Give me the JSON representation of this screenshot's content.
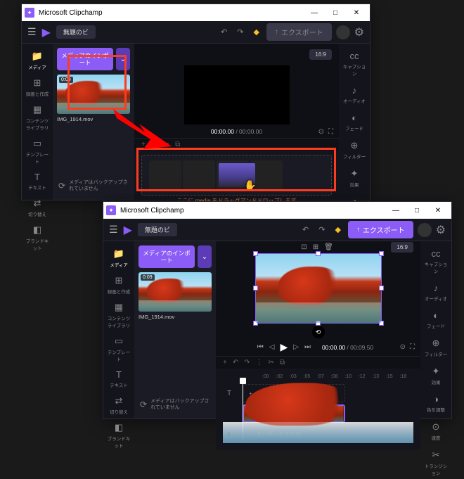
{
  "app": {
    "title": "Microsoft Clipchamp"
  },
  "win_controls": {
    "min": "—",
    "max": "□",
    "close": "✕"
  },
  "topbar": {
    "doc_title": "無題の‍ビ",
    "undo_icon": "↶",
    "redo_icon": "↷",
    "diamond_icon": "◆",
    "export_label": "エクスポート",
    "export_icon": "↑"
  },
  "aspect_ratio": "16:9",
  "left_rail": [
    {
      "icon": "📁",
      "label": "メディア"
    },
    {
      "icon": "⊞",
      "label": "録画と作成"
    },
    {
      "icon": "▦",
      "label": "コンテンツライブラリ"
    },
    {
      "icon": "▭",
      "label": "テンプレート"
    },
    {
      "icon": "T",
      "label": "テキスト"
    },
    {
      "icon": "⇄",
      "label": "切り替え"
    },
    {
      "icon": "◧",
      "label": "ブランドキット"
    }
  ],
  "media": {
    "import_label": "メディアのインポート",
    "chevron": "⌄",
    "clip": {
      "duration": "0:09",
      "filename": "IMG_1914.mov"
    },
    "backup_msg": "メディアはバックアップされていません"
  },
  "right_rail": [
    {
      "icon": "cc",
      "label": "キャプション"
    },
    {
      "icon": "♪",
      "label": "オーディオ"
    },
    {
      "icon": "◐",
      "label": "フェード"
    },
    {
      "icon": "⊕",
      "label": "フィルター"
    },
    {
      "icon": "✦",
      "label": "効果"
    },
    {
      "icon": "◑",
      "label": "色を調整"
    },
    {
      "icon": "⊙",
      "label": "速度"
    },
    {
      "icon": "✂",
      "label": "トランジション"
    }
  ],
  "playback": {
    "skip_back": "⏮",
    "prev": "◁",
    "play": "▶",
    "next": "▷",
    "skip_fwd": "⏭",
    "time_cur": "00:00.00",
    "time_sep": " / ",
    "time_tot_a": "00:00.00",
    "time_tot_b": "00:09.50",
    "full": "⛶",
    "search": "⊙"
  },
  "crop_tools": {
    "crop": "⊡",
    "fit": "⊞",
    "trash": "🗑"
  },
  "toolbar": {
    "plus": "+",
    "undo": "↶",
    "redo": "↷",
    "cut": "✂",
    "copy": "⧉",
    "sep": "⋮"
  },
  "timeline": {
    "drop_hint": "ここに media をドラッグアンドドロップします",
    "marks": [
      ":00",
      ":02",
      ":03",
      ":05",
      ":07",
      ":08",
      ":10",
      ":12",
      ":13",
      ":15",
      ":18"
    ],
    "text_track": "テキストを追加",
    "audio_track": "オーディオを追加",
    "text_icon": "T",
    "audio_icon": "♪",
    "track_plus": "+"
  }
}
